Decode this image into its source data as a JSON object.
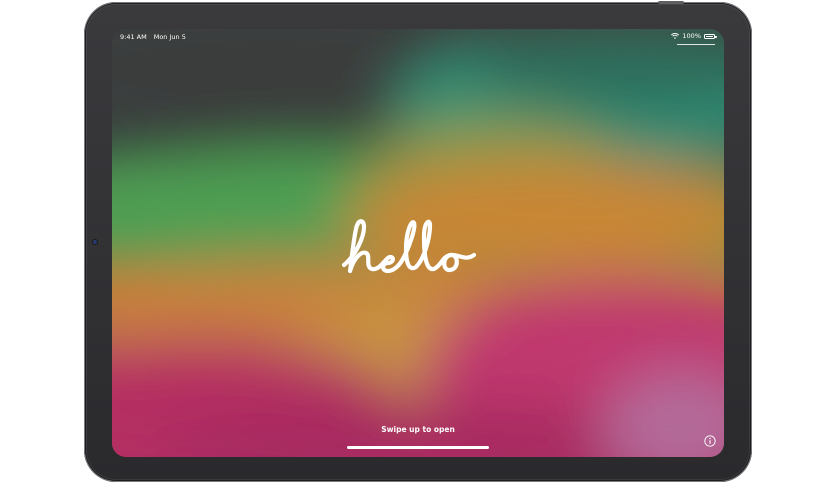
{
  "status_bar": {
    "time": "9:41 AM",
    "date": "Mon Jun 5",
    "battery": "100%",
    "battery_level": 1.0,
    "wifi_icon": "wifi-icon",
    "battery_icon": "battery-icon"
  },
  "greeting": {
    "text": "hello"
  },
  "lock_screen": {
    "prompt": "Swipe up to open",
    "info_icon": "info-icon"
  },
  "colors": {
    "bezel": "#2f2f32",
    "wallpaper_top": "#3c4b42",
    "wallpaper_green": "#4fa05a",
    "wallpaper_teal": "#2f8f77",
    "wallpaper_orange": "#c98a34",
    "wallpaper_pink": "#c0336f"
  }
}
